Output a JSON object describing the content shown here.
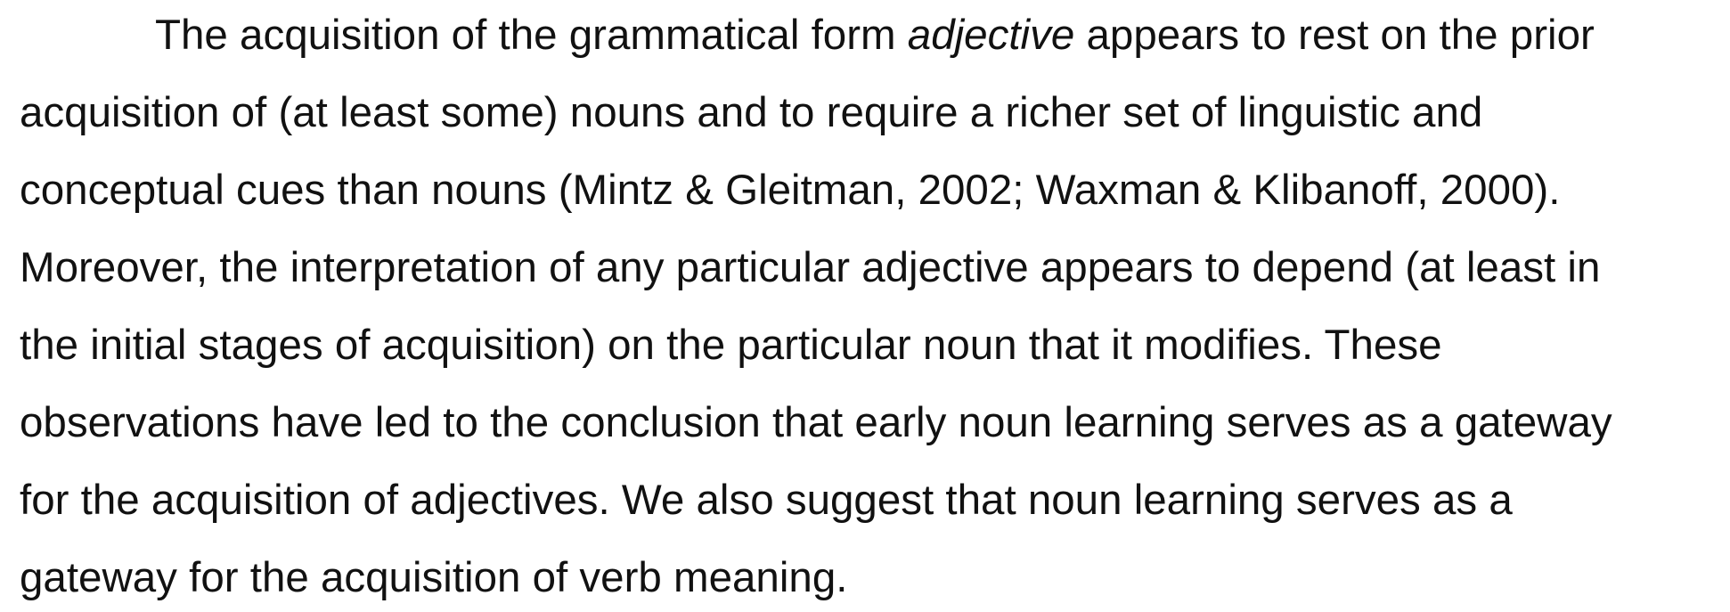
{
  "paragraph": {
    "line1": {
      "before": "The acquisition of the grammatical form ",
      "emphasis": "adjective",
      "after": " appears to rest on the prior"
    },
    "line2": "acquisition of (at least some) nouns and to require a richer set of linguistic and",
    "line3": "conceptual cues than nouns (Mintz & Gleitman, 2002; Waxman & Klibanoff, 2000).",
    "line4": "Moreover, the interpretation of any particular adjective appears to depend (at least in",
    "line5": "the initial stages of acquisition) on the particular noun that it modifies. These",
    "line6": "observations have led to the conclusion that early noun learning serves as a gateway",
    "line7": "for the acquisition of adjectives. We also suggest that noun learning serves as a",
    "line8": "gateway for the acquisition of verb meaning."
  }
}
